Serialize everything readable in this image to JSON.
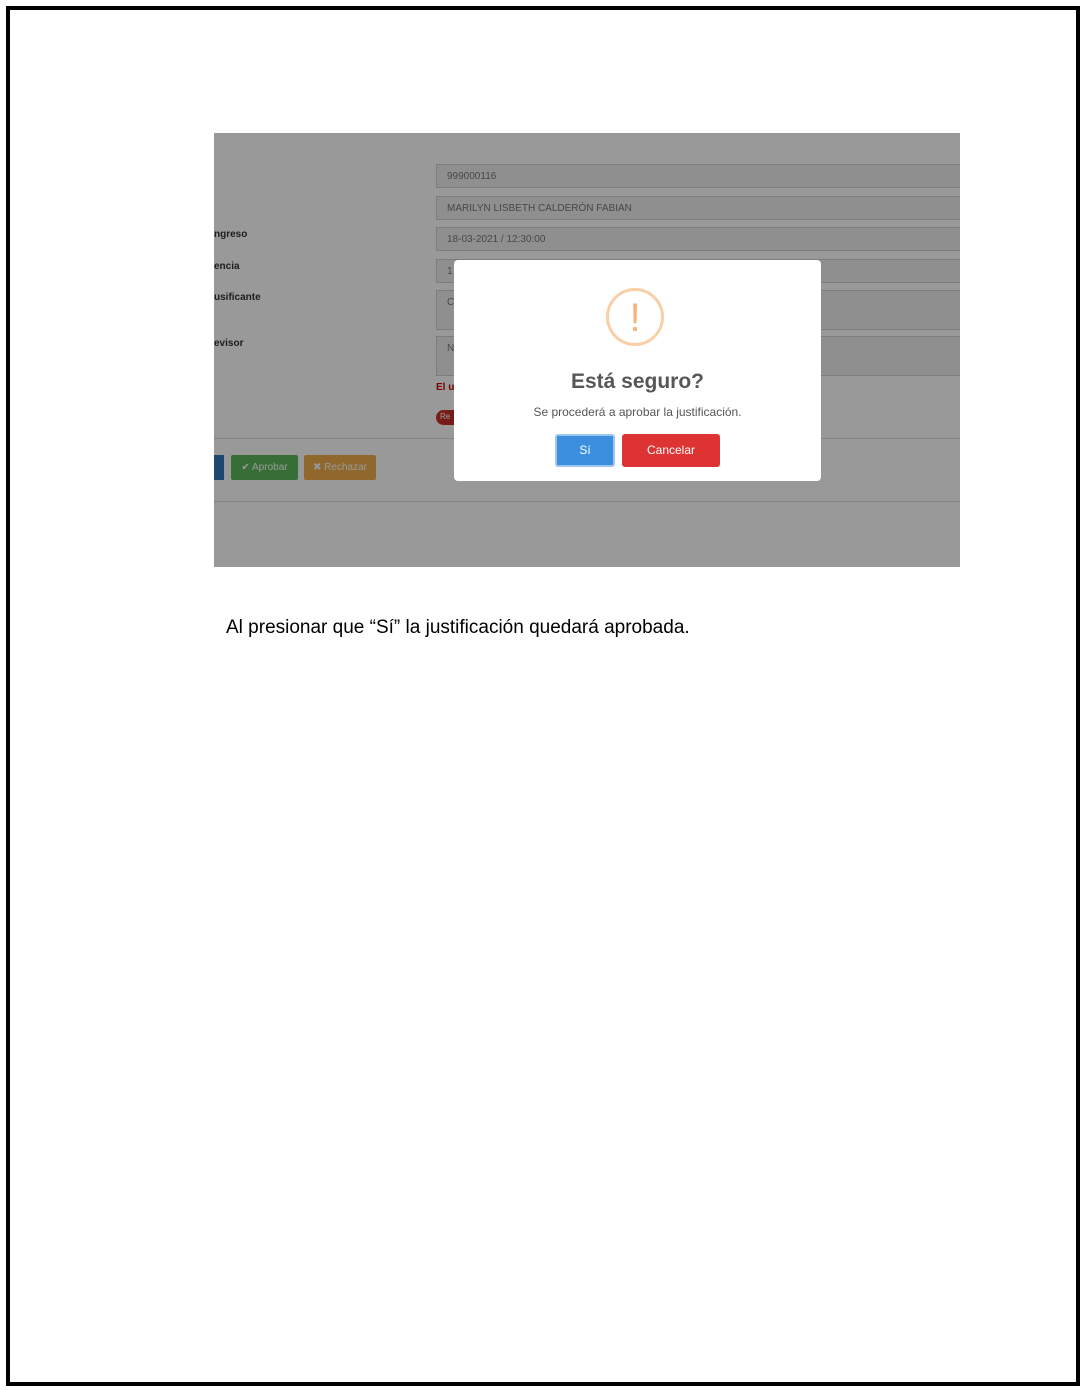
{
  "screenshot": {
    "fields": [
      {
        "label": "",
        "value": "999000116"
      },
      {
        "label": "",
        "value": "MARILYN LISBETH CALDERÓN FABIAN"
      },
      {
        "label": "ngreso",
        "value": "18-03-2021 / 12:30:00"
      },
      {
        "label": "encia",
        "value": "1"
      },
      {
        "label": "usificante",
        "value": "C"
      },
      {
        "label": "evisor",
        "value": "N"
      }
    ],
    "error_text": "El u",
    "pill_text": "Re",
    "approve_label": "✔ Aprobar",
    "reject_label": "✖ Rechazar",
    "dialog": {
      "icon": "!",
      "title": "Está seguro?",
      "text": "Se procederá a aprobar la justificación.",
      "yes_label": "Sí",
      "cancel_label": "Cancelar"
    }
  },
  "caption": "Al presionar que “Sí” la justificación quedará aprobada."
}
